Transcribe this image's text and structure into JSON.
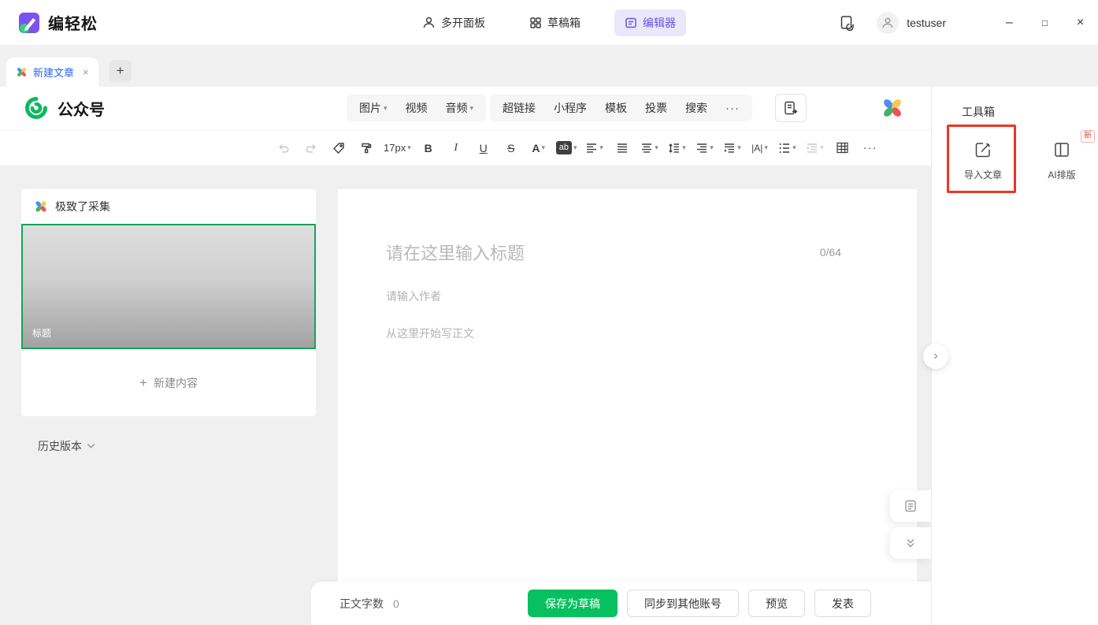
{
  "app": {
    "name": "编轻松",
    "user": "testuser",
    "window_controls": {
      "minimize": "–",
      "maximize": "□",
      "close": "×"
    }
  },
  "top_nav": {
    "multi_panel": "多开面板",
    "drafts": "草稿箱",
    "editor": "编辑器"
  },
  "tab_bar": {
    "active_tab": "新建文章",
    "close_glyph": "×",
    "new_tab_glyph": "+"
  },
  "header": {
    "platform": "公众号",
    "image": "图片",
    "video": "视频",
    "audio": "音频",
    "hyperlink": "超链接",
    "mini_program": "小程序",
    "template": "模板",
    "vote": "投票",
    "search": "搜索",
    "more_glyph": "···"
  },
  "format_toolbar": {
    "font_size": "17px",
    "bold": "B",
    "italic": "I",
    "underline": "U",
    "strikethrough": "S",
    "font_color": "A",
    "highlight": "ab",
    "letter_spacing": "|A|",
    "more_glyph": "···",
    "dropdown_glyph": "▾"
  },
  "collect_panel": {
    "title": "极致了采集",
    "thumbnail_label": "标题",
    "plus_glyph": "+",
    "new_content": "新建内容",
    "history_label": "历史版本"
  },
  "editor": {
    "title_placeholder": "请在这里输入标题",
    "title_count": "0/64",
    "author_placeholder": "请输入作者",
    "body_placeholder": "从这里开始写正文"
  },
  "toolbox": {
    "title": "工具箱",
    "import_article": "导入文章",
    "ai_layout": "AI排版",
    "ai_badge": "新",
    "collapse_glyph": "›"
  },
  "footer": {
    "word_count_label": "正文字数",
    "word_count": "0",
    "save_draft": "保存为草稿",
    "sync_accounts": "同步到其他账号",
    "preview": "预览",
    "publish": "发表"
  },
  "colors": {
    "accent_purple": "#6a52e0",
    "tab_blue": "#2a65ef",
    "brand_green": "#07c160",
    "select_green": "#17a35c",
    "annotation_red": "#ee3424",
    "badge_red": "#e0443a"
  }
}
